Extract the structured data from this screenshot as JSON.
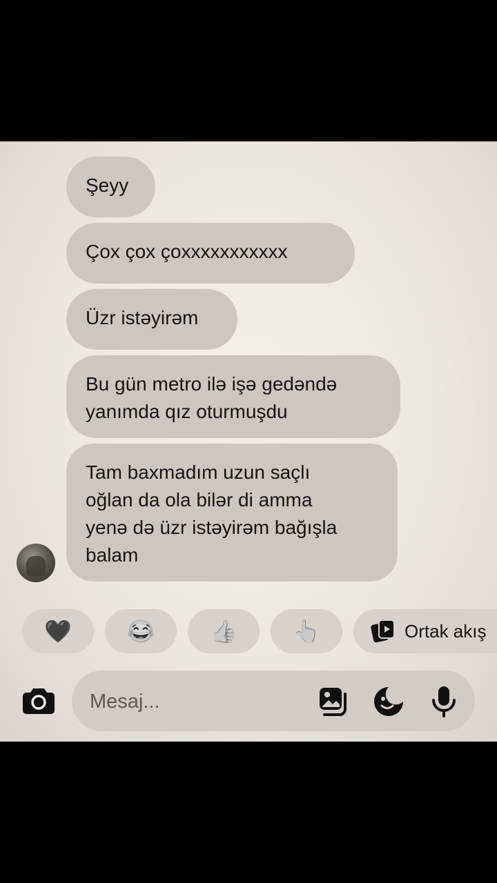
{
  "messages": [
    {
      "text": "Şeyy"
    },
    {
      "text": "Çox çox çoxxxxxxxxxxx"
    },
    {
      "text": "Üzr istəyirəm"
    },
    {
      "text": "Bu gün metro ilə işə gedəndə\nyanımda qız oturmuşdu"
    },
    {
      "text": "Tam baxmadım uzun saçlı\noğlan da ola bilər di amma\nyenə də üzr istəyirəm bağışla\nbalam"
    }
  ],
  "quick_replies": [
    {
      "emoji": "🖤",
      "icon": "heart-icon"
    },
    {
      "emoji": "😂",
      "icon": "laughing-face-icon"
    },
    {
      "emoji": "👍",
      "icon": "thumbs-up-icon"
    },
    {
      "emoji": "👆",
      "icon": "pointing-hand-icon"
    },
    {
      "label": "Ortak akış",
      "icon": "shared-feed-icon"
    }
  ],
  "composer": {
    "placeholder": "Mesaj..."
  },
  "colors": {
    "bubble": "#cdc7c2",
    "background": "#ebe7e2",
    "icon": "#111111"
  }
}
